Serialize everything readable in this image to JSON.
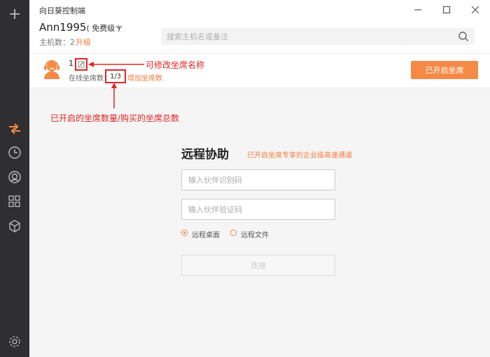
{
  "app": {
    "title": "向日葵控制端"
  },
  "account": {
    "name": "Ann1995",
    "tier": "( 免费级 )",
    "host_count": "主机数：2",
    "upgrade": "升级"
  },
  "search": {
    "placeholder": "搜索主机名或备注"
  },
  "seat": {
    "name": "1",
    "online_label": "在线坐席数：",
    "online_count": "1/3",
    "add_seats": "增加坐席数",
    "status_button": "已开启坐席"
  },
  "annotations": {
    "edit_name": "可修改坐席名称",
    "seat_count": "已开启的坐席数量/购买的坐席总数"
  },
  "remote": {
    "title": "远程协助",
    "subtitle": "已开启坐席专享的企业级高速通道",
    "partner_id_placeholder": "输入伙伴识别码",
    "partner_code_placeholder": "输入伙伴验证码",
    "mode_options": [
      "远程桌面",
      "远程文件"
    ],
    "selected_mode": "远程桌面",
    "connect": "连接"
  },
  "colors": {
    "accent": "#f58a46",
    "annotation": "#e02525",
    "sidebar": "#2f2f31"
  },
  "sidebar_icons": [
    "plus-icon",
    "remote-control-icon",
    "history-icon",
    "discovery-icon",
    "devices-icon",
    "cube-icon",
    "settings-icon"
  ]
}
